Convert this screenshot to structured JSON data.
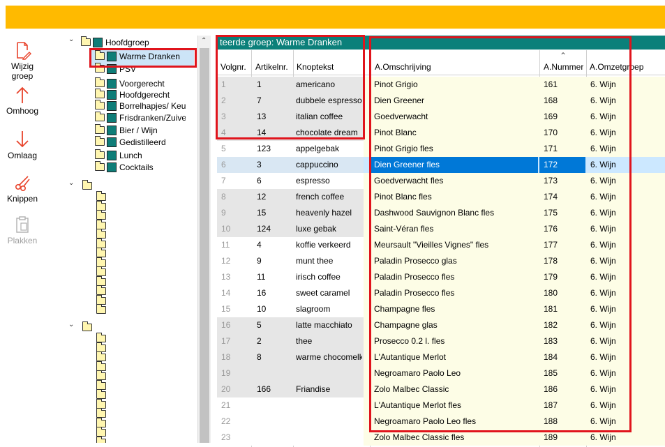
{
  "toolbar": {
    "wijzig": "Wijzig groep",
    "omhoog": "Omhoog",
    "omlaag": "Omlaag",
    "knippen": "Knippen",
    "plakken": "Plakken"
  },
  "tree": {
    "root": "Hoofdgroep",
    "items": [
      "Warme Dranken",
      "PSV",
      "Voorgerecht",
      "Hoofdgerecht",
      "Borrelhapjes/ Keu",
      "Frisdranken/Zuive",
      "Bier / Wijn",
      "Gedistilleerd",
      "Lunch",
      "Cocktails"
    ]
  },
  "selected_group_title": "teerde groep: Warme Dranken",
  "left_grid": {
    "headers": [
      "Volgnr.",
      "Artikelnr.",
      "Knoptekst"
    ],
    "rows": [
      [
        "1",
        "1",
        "americano"
      ],
      [
        "2",
        "7",
        "dubbele espresso"
      ],
      [
        "3",
        "13",
        "italian coffee"
      ],
      [
        "4",
        "14",
        "chocolate dream"
      ],
      [
        "5",
        "123",
        "appelgebak"
      ],
      [
        "6",
        "3",
        "cappuccino"
      ],
      [
        "7",
        "6",
        "espresso"
      ],
      [
        "8",
        "12",
        "french coffee"
      ],
      [
        "9",
        "15",
        "heavenly hazel"
      ],
      [
        "10",
        "124",
        "luxe gebak"
      ],
      [
        "11",
        "4",
        "koffie verkeerd"
      ],
      [
        "12",
        "9",
        "munt thee"
      ],
      [
        "13",
        "11",
        "irisch coffee"
      ],
      [
        "14",
        "16",
        "sweet caramel"
      ],
      [
        "15",
        "10",
        "slagroom"
      ],
      [
        "16",
        "5",
        "latte macchiato"
      ],
      [
        "17",
        "2",
        "thee"
      ],
      [
        "18",
        "8",
        "warme chocomelk"
      ],
      [
        "19",
        "",
        ""
      ],
      [
        "20",
        "166",
        "Friandise"
      ],
      [
        "21",
        "",
        ""
      ],
      [
        "22",
        "",
        ""
      ],
      [
        "23",
        "",
        ""
      ]
    ]
  },
  "right_grid": {
    "headers": [
      "A.Omschrijving",
      "A.Nummer",
      "A.Omzetgroep"
    ],
    "rows": [
      [
        "Pinot Grigio",
        "161",
        "6. Wijn"
      ],
      [
        "Dien Greener",
        "168",
        "6. Wijn"
      ],
      [
        "Goedverwacht",
        "169",
        "6. Wijn"
      ],
      [
        "Pinot Blanc",
        "170",
        "6. Wijn"
      ],
      [
        "Pinot Grigio fles",
        "171",
        "6. Wijn"
      ],
      [
        "Dien Greener fles",
        "172",
        "6. Wijn"
      ],
      [
        "Goedverwacht fles",
        "173",
        "6. Wijn"
      ],
      [
        "Pinot Blanc fles",
        "174",
        "6. Wijn"
      ],
      [
        "Dashwood Sauvignon Blanc fles",
        "175",
        "6. Wijn"
      ],
      [
        "Saint-Véran fles",
        "176",
        "6. Wijn"
      ],
      [
        "Meursault \"Vieilles Vignes\" fles",
        "177",
        "6. Wijn"
      ],
      [
        "Paladin Prosecco glas",
        "178",
        "6. Wijn"
      ],
      [
        "Paladin Prosecco fles",
        "179",
        "6. Wijn"
      ],
      [
        "Paladin Prosecco fles",
        "180",
        "6. Wijn"
      ],
      [
        "Champagne fles",
        "181",
        "6. Wijn"
      ],
      [
        "Champagne glas",
        "182",
        "6. Wijn"
      ],
      [
        "Prosecco 0.2 l. fles",
        "183",
        "6. Wijn"
      ],
      [
        "L'Autantique Merlot",
        "184",
        "6. Wijn"
      ],
      [
        "Negroamaro Paolo Leo",
        "185",
        "6. Wijn"
      ],
      [
        "Zolo Malbec Classic",
        "186",
        "6. Wijn"
      ],
      [
        "L'Autantique Merlot fles",
        "187",
        "6. Wijn"
      ],
      [
        "Negroamaro Paolo Leo fles",
        "188",
        "6. Wijn"
      ],
      [
        "Zolo Malbec Classic fles",
        "189",
        "6. Wijn"
      ]
    ]
  },
  "colors": {
    "accent_bar": "#ffba00",
    "teal": "#0b807a",
    "highlight": "#e0141c",
    "selection": "#0078d7"
  }
}
